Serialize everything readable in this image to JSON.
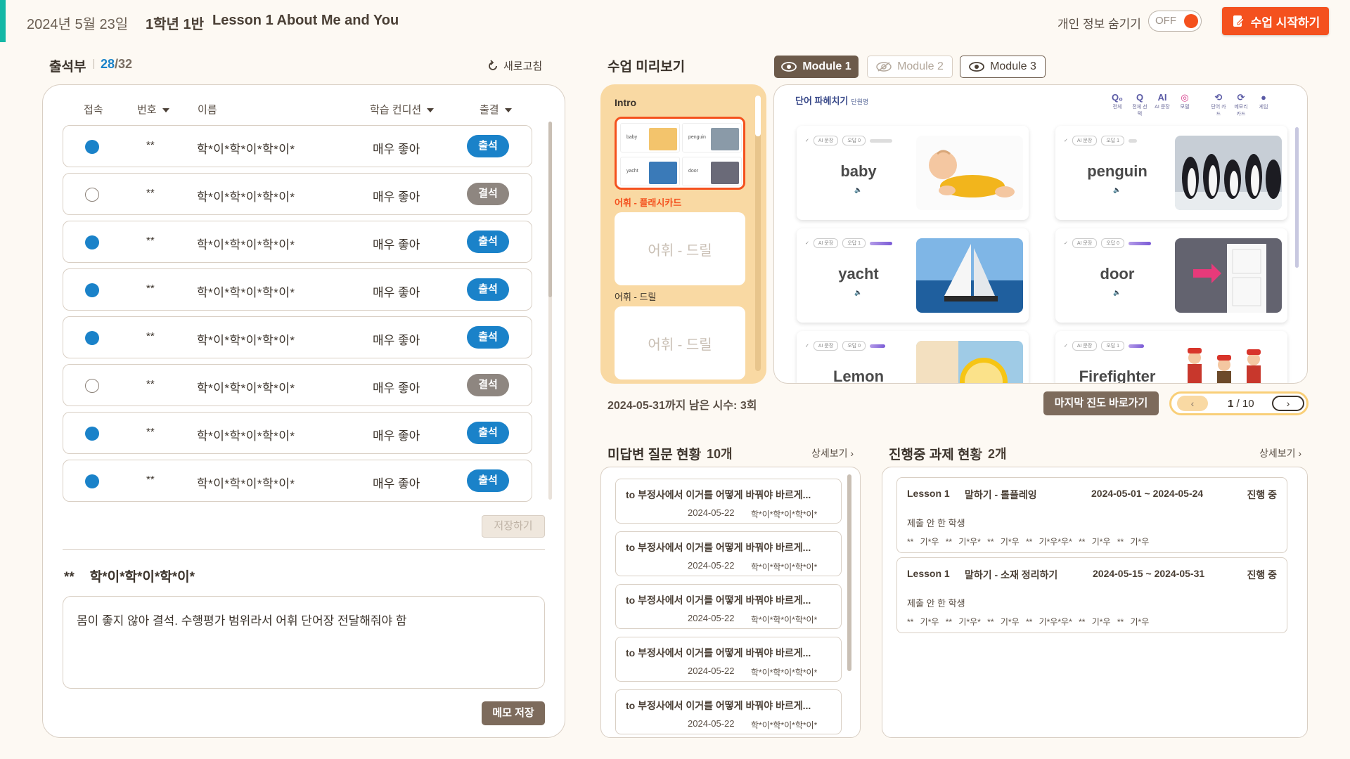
{
  "header": {
    "date": "2024년 5월 23일",
    "class": "1학년 1반",
    "lesson": "Lesson 1 About Me and You",
    "privacy_label": "개인 정보 숨기기",
    "privacy_toggle": "OFF",
    "start_label": "수업 시작하기",
    "accent_color": "#f4511e"
  },
  "attendance": {
    "title": "출석부",
    "present": "28",
    "total": "/32",
    "refresh_label": "새로고침",
    "columns": {
      "connect": "접속",
      "number": "번호",
      "name": "이름",
      "condition": "학습 컨디션",
      "status": "출결"
    },
    "rows": [
      {
        "connected": true,
        "num": "**",
        "name": "학*이*학*이*학*이*",
        "condition": "매우 좋아",
        "status": "출석"
      },
      {
        "connected": false,
        "num": "**",
        "name": "학*이*학*이*학*이*",
        "condition": "매우 좋아",
        "status": "결석"
      },
      {
        "connected": true,
        "num": "**",
        "name": "학*이*학*이*학*이*",
        "condition": "매우 좋아",
        "status": "출석"
      },
      {
        "connected": true,
        "num": "**",
        "name": "학*이*학*이*학*이*",
        "condition": "매우 좋아",
        "status": "출석"
      },
      {
        "connected": true,
        "num": "**",
        "name": "학*이*학*이*학*이*",
        "condition": "매우 좋아",
        "status": "출석"
      },
      {
        "connected": false,
        "num": "**",
        "name": "학*이*학*이*학*이*",
        "condition": "매우 좋아",
        "status": "결석"
      },
      {
        "connected": true,
        "num": "**",
        "name": "학*이*학*이*학*이*",
        "condition": "매우 좋아",
        "status": "출석"
      },
      {
        "connected": true,
        "num": "**",
        "name": "학*이*학*이*학*이*",
        "condition": "매우 좋아",
        "status": "출석"
      }
    ],
    "save_label": "저장하기",
    "memo": {
      "num": "**",
      "name": "학*이*학*이*학*이*",
      "text": "몸이 좋지 않아 결석. 수행평가 범위라서 어휘 단어장 전달해줘야 함",
      "save_label": "메모 저장"
    }
  },
  "preview": {
    "title": "수업 미리보기",
    "modules": [
      "Module 1",
      "Module 2",
      "Module 3"
    ],
    "lesson_list": {
      "intro": "Intro",
      "thumb_words": [
        "baby",
        "penguin",
        "yacht",
        "door"
      ],
      "caption1": "어휘 - 플래시카드",
      "card_label": "어휘 - 드릴",
      "caption2": "어휘 - 드릴"
    },
    "board": {
      "title": "단어 파헤치기",
      "subtitle": "단원명",
      "tools": [
        {
          "icon": "Q₀",
          "label": "전체"
        },
        {
          "icon": "Q",
          "label": "전체 선택"
        },
        {
          "icon": "AI",
          "label": "AI 문장"
        },
        {
          "icon": "◎",
          "label": "모델"
        },
        {
          "icon": "⟲",
          "label": "단어 카드"
        },
        {
          "icon": "⟳",
          "label": "메모리 카드"
        },
        {
          "icon": "●",
          "label": "게임"
        }
      ],
      "pill_ai": "AI 문장",
      "cards": [
        {
          "word": "baby",
          "tag": "오답 0",
          "image": "baby-photo"
        },
        {
          "word": "penguin",
          "tag": "오답 1",
          "image": "penguin-photo"
        },
        {
          "word": "yacht",
          "tag": "오답 1",
          "image": "yacht-photo"
        },
        {
          "word": "door",
          "tag": "오답 0",
          "image": "door-photo"
        },
        {
          "word": "Lemon",
          "tag": "오답 0",
          "image": "lemon-photo"
        },
        {
          "word": "Firefighter",
          "tag": "오답 1",
          "image": "firefighter-illustration"
        }
      ]
    },
    "remaining": "2024-05-31까지 남은 시수: 3회",
    "last_progress_label": "마지막 진도 바로가기",
    "pager": {
      "current": "1",
      "sep": "/",
      "total": "10"
    }
  },
  "questions": {
    "title": "미답변 질문 현황",
    "count": "10개",
    "more_label": "상세보기",
    "items": [
      {
        "text": "to 부정사에서 이거를 어떻게 바꿔야 바르게...",
        "date": "2024-05-22",
        "who": "학*이*학*이*학*이*"
      },
      {
        "text": "to 부정사에서 이거를 어떻게 바꿔야 바르게...",
        "date": "2024-05-22",
        "who": "학*이*학*이*학*이*"
      },
      {
        "text": "to 부정사에서 이거를 어떻게 바꿔야 바르게...",
        "date": "2024-05-22",
        "who": "학*이*학*이*학*이*"
      },
      {
        "text": "to 부정사에서 이거를 어떻게 바꿔야 바르게...",
        "date": "2024-05-22",
        "who": "학*이*학*이*학*이*"
      },
      {
        "text": "to 부정사에서 이거를 어떻게 바꿔야 바르게...",
        "date": "2024-05-22",
        "who": "학*이*학*이*학*이*"
      }
    ]
  },
  "tasks": {
    "title": "진행중 과제 현황",
    "count": "2개",
    "more_label": "상세보기",
    "items": [
      {
        "lesson": "Lesson 1",
        "name": "말하기 - 롤플레잉",
        "range": "2024-05-01 ~ 2024-05-24",
        "status": "진행 중",
        "sub": "제출 안 한 학생",
        "students": "** 기*우  ** 기*우*  ** 기*우  ** 기*우*우*  ** 기*우  ** 기*우"
      },
      {
        "lesson": "Lesson 1",
        "name": "말하기 - 소재 정리하기",
        "range": "2024-05-15 ~ 2024-05-31",
        "status": "진행 중",
        "sub": "제출 안 한 학생",
        "students": "** 기*우  ** 기*우*  ** 기*우  ** 기*우*우*  ** 기*우  ** 기*우"
      }
    ]
  }
}
